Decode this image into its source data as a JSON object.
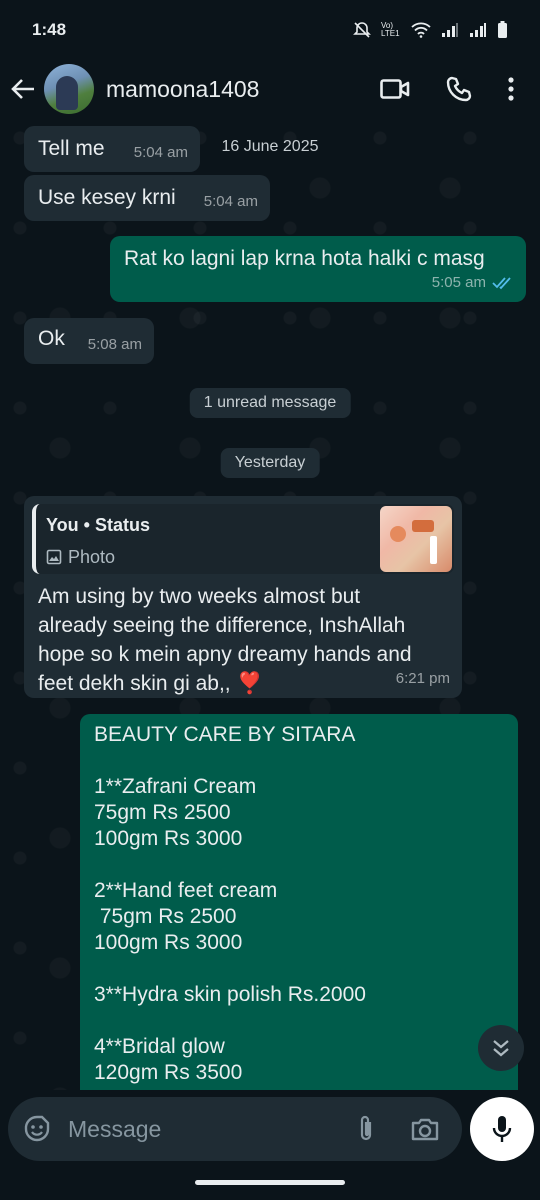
{
  "status_bar": {
    "time": "1:48",
    "net_label": "Vo) LTE1"
  },
  "header": {
    "contact_name": "mamoona1408"
  },
  "messages": {
    "m1": {
      "text": "Tell me",
      "time": "5:04 am"
    },
    "date1": "16 June 2025",
    "m2": {
      "text": "Use kesey krni",
      "time": "5:04 am"
    },
    "m3": {
      "text": "Rat ko lagni lap krna hota halki c masg",
      "time": "5:05 am"
    },
    "m4": {
      "text": "Ok",
      "time": "5:08 am"
    },
    "unread": "1 unread message",
    "date2": "Yesterday",
    "m5": {
      "quote_title": "You • Status",
      "quote_sub": "Photo",
      "line1": "Am using by two weeks almost but",
      "line2": "already seeing the difference, InshAllah",
      "line3": "hope so k mein apny dreamy hands and",
      "line4": "feet dekh skin gi ab,, ❣️",
      "time": "6:21 pm"
    },
    "m6": {
      "lines": [
        "BEAUTY CARE BY SITARA",
        "",
        "1**Zafrani Cream",
        "75gm Rs 2500",
        "100gm Rs 3000",
        "",
        "2**Hand feet cream",
        " 75gm Rs 2500",
        "100gm Rs 3000",
        "",
        "3**Hydra skin polish Rs.2000",
        "",
        "4**Bridal glow",
        "120gm Rs 3500"
      ]
    }
  },
  "input": {
    "placeholder": "Message"
  },
  "colors": {
    "background": "#0b141a",
    "incoming": "#1f2c34",
    "outgoing": "#005c4b",
    "read_ticks": "#53bdeb"
  }
}
